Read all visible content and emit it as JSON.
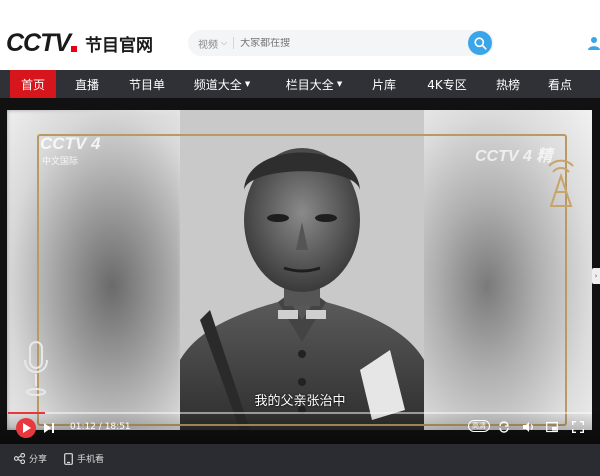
{
  "header": {
    "logo_text": "CCTV",
    "logo_sub": "节目官网",
    "search_category": "视频",
    "search_placeholder": "大家都在搜"
  },
  "nav": {
    "items": [
      {
        "label": "首页",
        "active": true
      },
      {
        "label": "直播"
      },
      {
        "label": "节目单"
      },
      {
        "label": "频道大全",
        "dropdown": true
      },
      {
        "label": "栏目大全",
        "dropdown": true
      },
      {
        "label": "片库"
      },
      {
        "label": "4K专区"
      },
      {
        "label": "热榜"
      },
      {
        "label": "看点"
      }
    ]
  },
  "player": {
    "channel_logo": "CCTV 4",
    "channel_sub": "中文国际",
    "channel_logo_right": "CCTV 4 精",
    "subtitle": "我的父亲张治中",
    "current_time": "01:12",
    "duration": "18:51",
    "time_sep": " / ",
    "progress_fraction": 0.0637,
    "quality_label": "高清"
  },
  "footer": {
    "share_label": "分享",
    "mobile_label": "手机看"
  },
  "colors": {
    "accent_red": "#d6161c",
    "nav_bg": "#2f3137",
    "search_blue": "#3aa5e8",
    "frame_gold": "#b89a64"
  }
}
